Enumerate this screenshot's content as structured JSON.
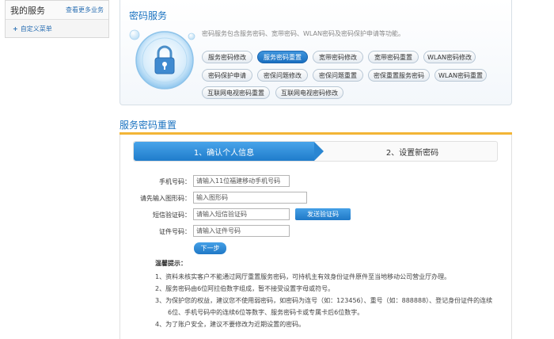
{
  "sidebar": {
    "title": "我的服务",
    "more_link": "查看更多业务",
    "custom_menu": "自定义菜单",
    "custom_prefix": "+"
  },
  "service_panel": {
    "title": "密码服务",
    "description": "密码服务包含服务密码、宽带密码、WLAN密码及密码保护申请等功能。",
    "buttons": [
      {
        "label": "服务密码修改",
        "active": false
      },
      {
        "label": "服务密码重置",
        "active": true
      },
      {
        "label": "宽带密码修改",
        "active": false
      },
      {
        "label": "宽带密码重置",
        "active": false
      },
      {
        "label": "WLAN密码修改",
        "active": false
      },
      {
        "label": "密码保护申请",
        "active": false
      },
      {
        "label": "密保问题修改",
        "active": false
      },
      {
        "label": "密保问题重置",
        "active": false
      },
      {
        "label": "密保重置服务密码",
        "active": false
      },
      {
        "label": "WLAN密码重置",
        "active": false
      },
      {
        "label": "互联网电视密码重置",
        "active": false
      },
      {
        "label": "互联网电视密码修改",
        "active": false
      }
    ]
  },
  "section_title": "服务密码重置",
  "steps": {
    "step1": "1、确认个人信息",
    "step2": "2、设置新密码"
  },
  "form": {
    "phone": {
      "label": "手机号码：",
      "placeholder": "请输入11位福建移动手机号码"
    },
    "captcha": {
      "label": "请先输入图形码：",
      "placeholder": "输入图形码"
    },
    "sms": {
      "label": "短信验证码：",
      "placeholder": "请输入短信验证码"
    },
    "send_button": "发送验证码",
    "idcard": {
      "label": "证件号码：",
      "placeholder": "请输入证件号码"
    },
    "next_button": "下一步"
  },
  "tips": {
    "title": "温馨提示：",
    "items": [
      "1、资料未核实客户不能通过网厅重置服务密码，可持机主有效身份证件原件至当地移动公司营业厅办理。",
      "2、服务密码由6位阿拉伯数字组成，暂不接受设置字母或符号。",
      "3、为保护您的权益，建议您不使用弱密码，如密码为连号（如：123456）、重号（如：888888）、登记身份证件的连续",
      "6位、手机号码中的连续6位等数字、服务密码卡或专属卡后6位数字。",
      "4、为了账户安全，建议不要修改为近期设置的密码。"
    ]
  },
  "colors": {
    "accent": "#1b73c0",
    "active_button": "#2a86d2",
    "section_underline": "#f3b536"
  }
}
